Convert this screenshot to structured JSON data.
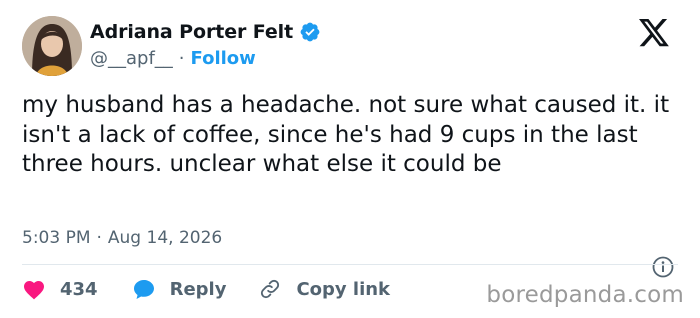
{
  "author": {
    "display_name": "Adriana Porter Felt",
    "handle": "@__apf__",
    "follow_label": "Follow",
    "separator": "·"
  },
  "tweet": {
    "text": "my husband has a headache. not sure what caused it. it isn't a lack of coffee, since he's had 9 cups in the last three hours. unclear what else it could be",
    "time": "5:03 PM",
    "date": "Aug 14, 2026",
    "separator": "·"
  },
  "actions": {
    "like_count": "434",
    "reply_label": "Reply",
    "copy_link_label": "Copy link"
  },
  "watermark": "boredpanda.com",
  "icons": {
    "verified": "verified-badge-icon",
    "x_logo": "x-logo-icon",
    "info": "info-icon",
    "like": "heart-icon",
    "reply": "speech-bubble-icon",
    "copy_link": "link-icon"
  },
  "colors": {
    "accent_blue": "#1d9bf0",
    "like_pink": "#f91880",
    "text_primary": "#0f1419",
    "text_secondary": "#536471",
    "watermark_gray": "#9a9a9a"
  }
}
